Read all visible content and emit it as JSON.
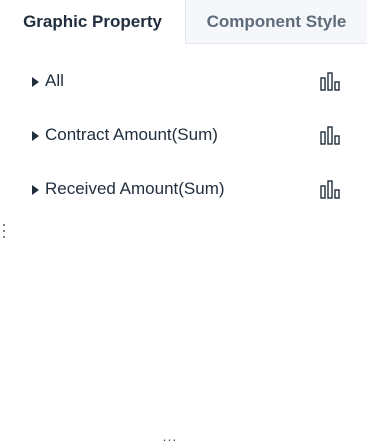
{
  "tabs": [
    {
      "label": "Graphic Property",
      "active": true
    },
    {
      "label": "Component Style",
      "active": false
    }
  ],
  "rows": [
    {
      "label": "All",
      "icon": "bar-chart-icon",
      "expand_icon": "caret-right-icon"
    },
    {
      "label": "Contract Amount(Sum)",
      "icon": "bar-chart-icon",
      "expand_icon": "caret-right-icon"
    },
    {
      "label": "Received Amount(Sum)",
      "icon": "bar-chart-icon",
      "expand_icon": "caret-right-icon"
    }
  ],
  "handles": {
    "top": "...",
    "bottom": "..."
  },
  "colors": {
    "text": "#1f2d3d",
    "inactive_tab_text": "#5f6b7a",
    "inactive_tab_bg": "#f5f7fa",
    "border": "#e4e7ed"
  }
}
